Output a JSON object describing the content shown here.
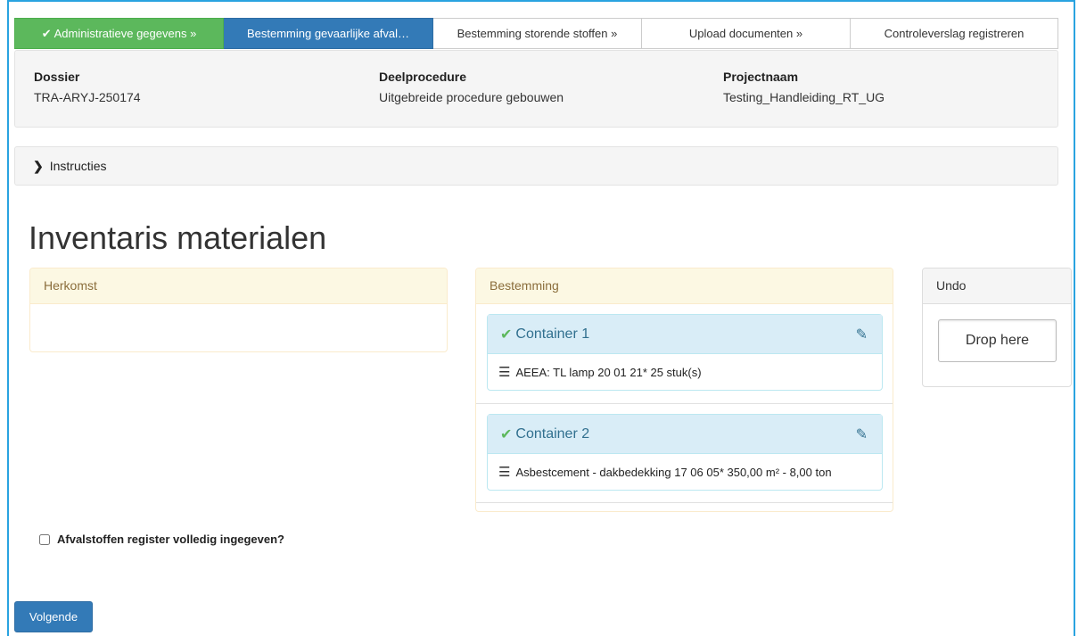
{
  "wizard": {
    "steps": [
      {
        "label": "Administratieve gegevens »",
        "state": "done"
      },
      {
        "label": "Bestemming gevaarlijke afval…",
        "state": "active"
      },
      {
        "label": "Bestemming storende stoffen »",
        "state": "pending"
      },
      {
        "label": "Upload documenten »",
        "state": "pending"
      },
      {
        "label": "Controleverslag registreren",
        "state": "pending"
      }
    ]
  },
  "dossier_info": {
    "dossier_label": "Dossier",
    "dossier_value": "TRA-ARYJ-250174",
    "deelprocedure_label": "Deelprocedure",
    "deelprocedure_value": "Uitgebreide procedure gebouwen",
    "projectnaam_label": "Projectnaam",
    "projectnaam_value": "Testing_Handleiding_RT_UG"
  },
  "instructions": {
    "label": "Instructies"
  },
  "page_title": "Inventaris materialen",
  "herkomst": {
    "title": "Herkomst"
  },
  "bestemming": {
    "title": "Bestemming",
    "containers": [
      {
        "name": "Container 1",
        "items": [
          "AEEA: TL lamp 20 01 21* 25 stuk(s)"
        ]
      },
      {
        "name": "Container 2",
        "items": [
          "Asbestcement - dakbedekking 17 06 05* 350,00 m² - 8,00 ton"
        ]
      }
    ]
  },
  "undo": {
    "title": "Undo",
    "drop_label": "Drop here"
  },
  "register_checkbox": {
    "label": "Afvalstoffen register volledig ingegeven?",
    "checked": false
  },
  "next_button": {
    "label": "Volgende"
  },
  "colors": {
    "done": "#5cb85c",
    "active": "#337ab7",
    "warning_header": "#fcf8e3",
    "info_header": "#d9edf7"
  }
}
